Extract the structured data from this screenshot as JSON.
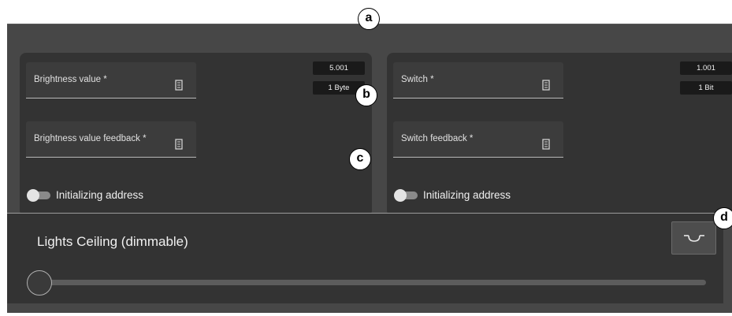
{
  "left_card": {
    "field_1": {
      "label": "Brightness value *",
      "icon": "document-icon"
    },
    "field_2": {
      "label": "Brightness value feedback *",
      "icon": "document-icon"
    },
    "address": "5.001",
    "datatype": "1 Byte",
    "toggle_label": "Initializing address",
    "toggle_on": false
  },
  "right_card": {
    "field_1": {
      "label": "Switch *",
      "icon": "document-icon"
    },
    "field_2": {
      "label": "Switch feedback *",
      "icon": "document-icon"
    },
    "address": "1.001",
    "datatype": "1 Bit",
    "toggle_label": "Initializing address",
    "toggle_on": false
  },
  "markers": {
    "a": "a",
    "b": "b",
    "c": "c",
    "d": "d"
  },
  "lights_panel": {
    "title": "Lights Ceiling (dimmable)",
    "switch_icon": "switch-symbol-icon",
    "slider_value_percent": 0
  },
  "colors": {
    "card_bg": "#333333",
    "area_bg": "#474747",
    "badge_bg": "#1a1a1a",
    "text": "#e6e6e6"
  }
}
